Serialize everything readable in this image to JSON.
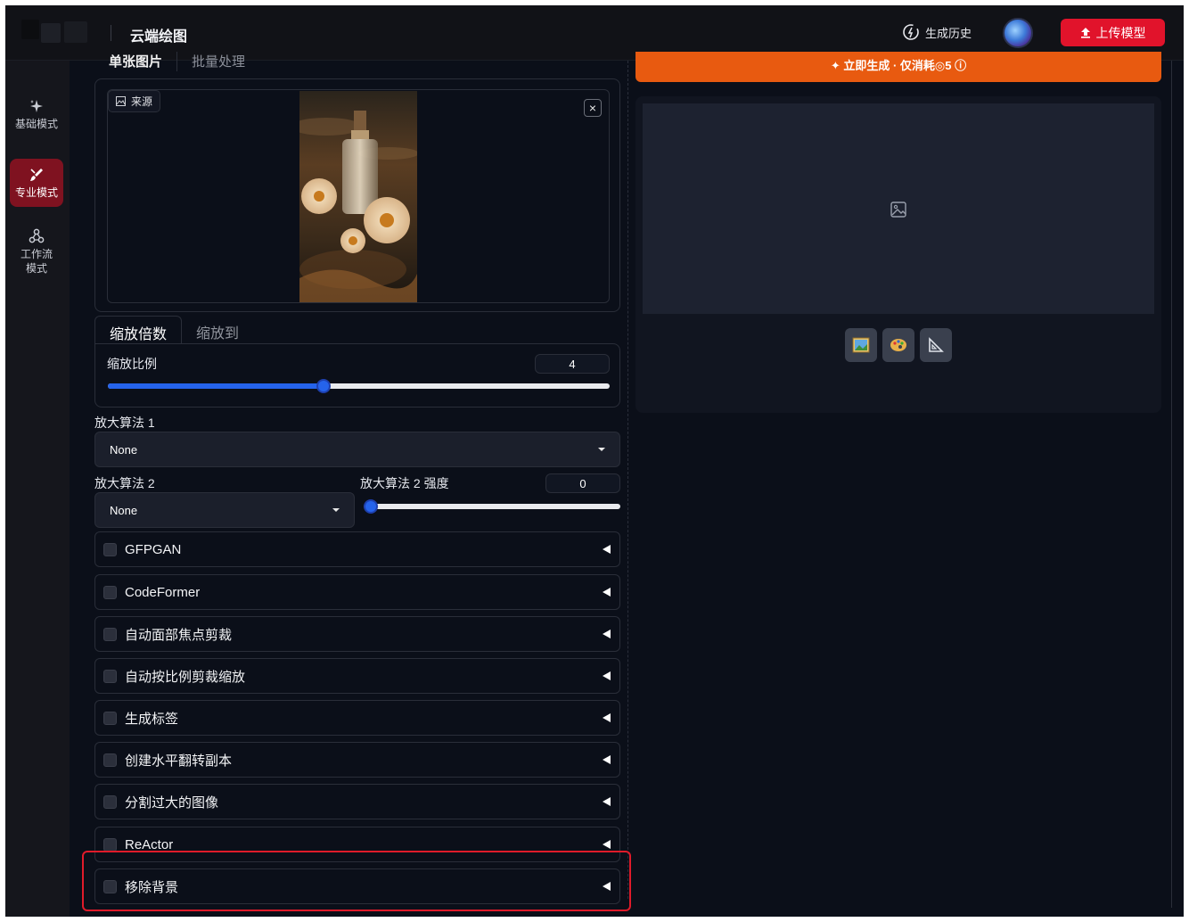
{
  "header": {
    "title": "云端绘图",
    "history_label": "生成历史",
    "upload_label": "上传模型"
  },
  "sidebar": {
    "items": [
      {
        "label": "基础模式"
      },
      {
        "label": "专业模式"
      },
      {
        "label": "工作流模式"
      }
    ]
  },
  "source": {
    "tabs": [
      "单张图片",
      "批量处理"
    ],
    "label": "来源",
    "close_symbol": "×"
  },
  "scale": {
    "tabs": [
      "缩放倍数",
      "缩放到"
    ],
    "ratio_label": "缩放比例",
    "ratio_value": "4",
    "ratio_fraction": 0.43
  },
  "upscaler1": {
    "label": "放大算法 1",
    "value": "None"
  },
  "upscaler2": {
    "label": "放大算法 2",
    "value": "None"
  },
  "upscaler2_strength": {
    "label": "放大算法 2 强度",
    "value": "0",
    "fraction": 0.0
  },
  "accordions": [
    "GFPGAN",
    "CodeFormer",
    "自动面部焦点剪裁",
    "自动按比例剪裁缩放",
    "生成标签",
    "创建水平翻转副本",
    "分割过大的图像",
    "ReActor",
    "移除背景"
  ],
  "generate": {
    "label": "✦ 立即生成 · 仅消耗◎5 ⓘ"
  },
  "colors": {
    "accent_red": "#e1132b",
    "generate_orange": "#e85a10",
    "slider_blue": "#2563eb",
    "highlight_red": "#e01b2a"
  }
}
